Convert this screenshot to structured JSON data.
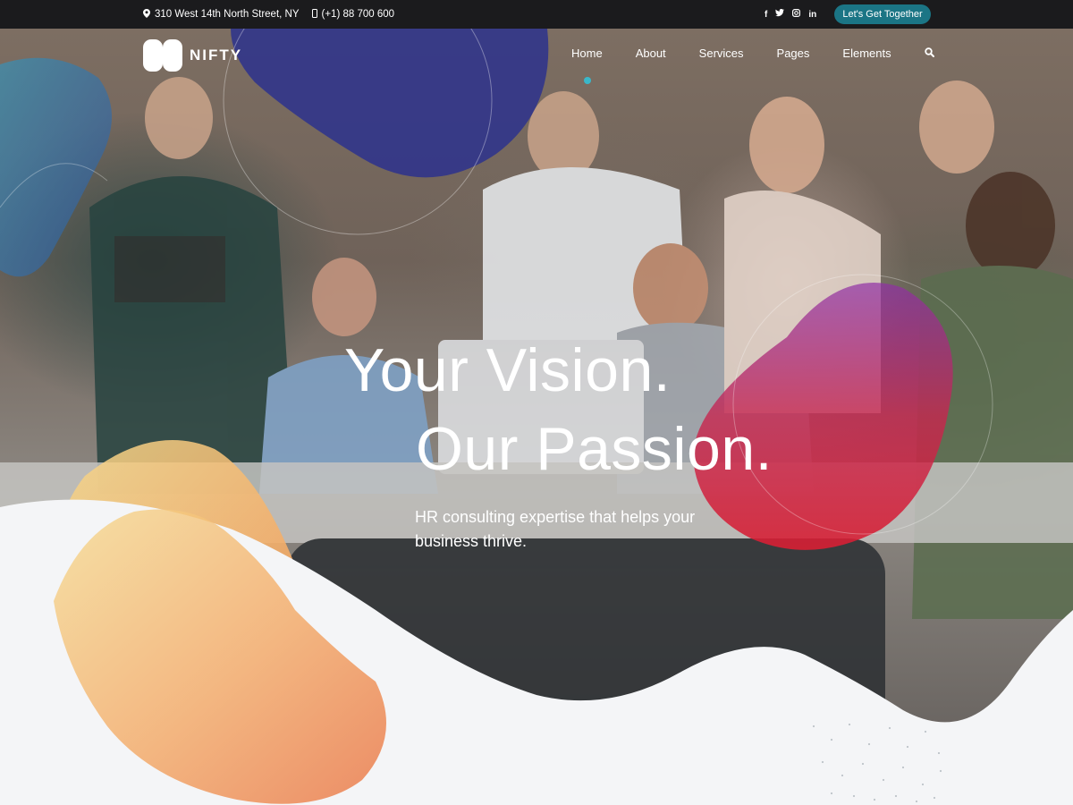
{
  "topbar": {
    "address": "310 West 14th North Street, NY",
    "phone": "(+1) 88 700 600",
    "socials": [
      "f",
      "t",
      "ig",
      "in"
    ],
    "cta_label": "Let's Get Together"
  },
  "brand": {
    "name": "NIFTY"
  },
  "nav": {
    "items": [
      "Home",
      "About",
      "Services",
      "Pages",
      "Elements"
    ]
  },
  "hero": {
    "headline_line1": "Your Vision.",
    "headline_line2": "Our Passion.",
    "subheading": "HR consulting expertise that helps your business thrive."
  },
  "colors": {
    "topbar_bg": "#1b1b1d",
    "accent": "#1b7585",
    "blob_navy": "#2a2f8f",
    "blob_red": "#d21f3c",
    "blob_orange": "#f4a261",
    "wave": "#f4f5f7"
  },
  "icons": {
    "address": "map-pin-icon",
    "phone": "phone-icon",
    "search": "search-icon"
  }
}
